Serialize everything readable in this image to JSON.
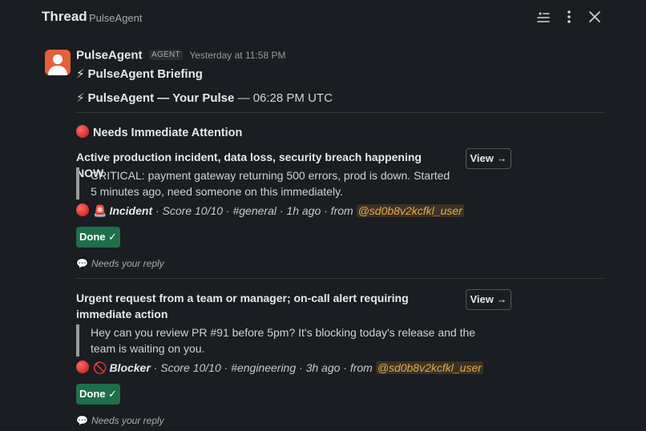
{
  "header": {
    "title": "Thread",
    "subtitle": "PulseAgent",
    "icons": [
      "filter-list-icon",
      "more-vertical-icon",
      "close-icon"
    ]
  },
  "message": {
    "sender": "PulseAgent",
    "badge": "AGENT",
    "timestamp": "Yesterday at 11:58 PM",
    "briefing_emoji": "⚡",
    "briefing_title": "PulseAgent Briefing",
    "pulse_emoji": "⚡",
    "pulse_title": "PulseAgent — Your Pulse",
    "pulse_time": " — 06:28 PM UTC",
    "section_title": "Needs Immediate Attention",
    "items": [
      {
        "title": "Active production incident, data loss, security breach happening NOW",
        "view_label": "View →",
        "quote": "CRITICAL: payment gateway returning 500 errors, prod is down. Started 5 minutes ago, need someone on this immediately.",
        "emoji": "🚨",
        "kind": "Incident",
        "details": " · Score 10/10 · #general · 1h ago · from ",
        "mention": "@sd0b8v2kcfkl_user",
        "done_label": "Done ✓",
        "reply_icon": "💬",
        "reply_note": "Needs your reply"
      },
      {
        "title": "Urgent request from a team or manager; on-call alert requiring immediate action",
        "view_label": "View →",
        "quote": "Hey can you review PR #91 before 5pm? It's blocking today's release and the team is waiting on you.",
        "emoji": "🚫",
        "kind": "Blocker",
        "details": " · Score 10/10 · #engineering · 3h ago · from ",
        "mention": "@sd0b8v2kcfkl_user",
        "done_label": "Done ✓",
        "reply_icon": "💬",
        "reply_note": "Needs your reply"
      }
    ]
  },
  "colors": {
    "background": "#1a1d21",
    "done_button": "#1f6f4a",
    "mention": "#e8a94a",
    "avatar": "#e5603b",
    "alert_dot": "#d32f2f"
  }
}
